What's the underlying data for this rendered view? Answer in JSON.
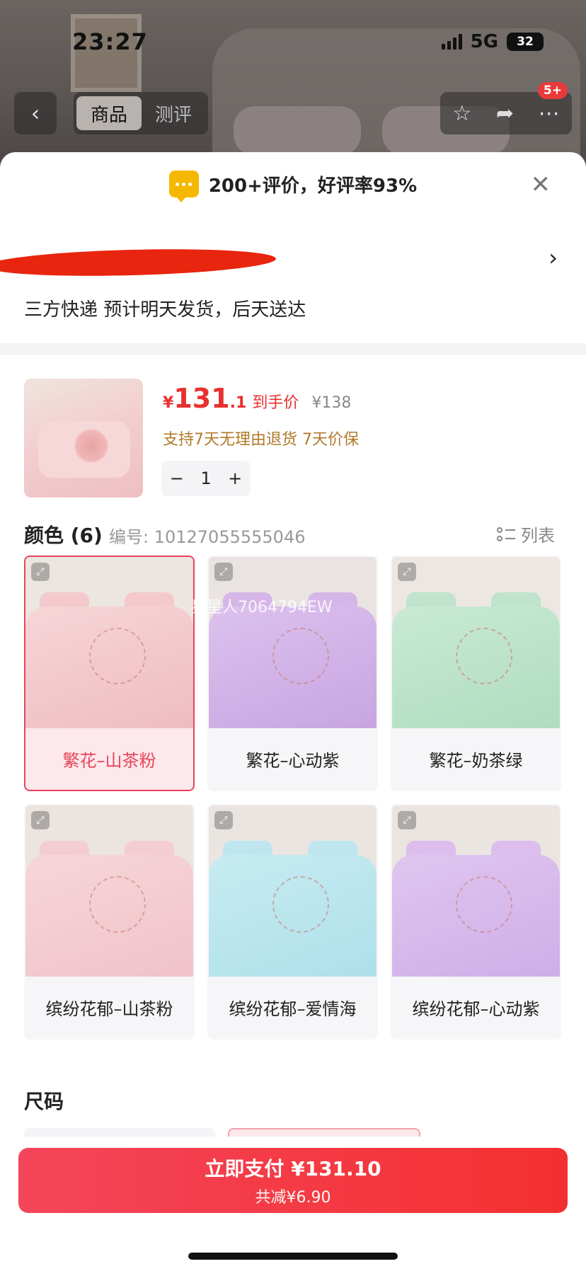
{
  "status_bar": {
    "time": "23:27",
    "network": "5G",
    "battery": "32"
  },
  "nav": {
    "back_icon": "chevron-left-icon",
    "tabs": [
      "商品",
      "测评"
    ],
    "actions": [
      "star-icon",
      "share-icon",
      "more-icon"
    ],
    "badge": "5+"
  },
  "sheet": {
    "rating_text": "200+评价，好评率93%",
    "delivery_text": "三方快递 预计明天发货，后天送达",
    "product": {
      "currency": "¥",
      "price_int": "131",
      "price_dec": ".1",
      "price_label": "到手价",
      "original_price": "¥138",
      "guarantee": "支持7天无理由退货  7天价保",
      "quantity": "1",
      "minus": "−",
      "plus": "+"
    },
    "color_section": {
      "title": "颜色 (6)",
      "code": "编号: 10127055555046",
      "list_label": "列表",
      "watermark": "星星人7064794EW",
      "options": [
        {
          "label": "繁花–山茶粉",
          "selected": true
        },
        {
          "label": "繁花–心动紫",
          "selected": false
        },
        {
          "label": "繁花–奶茶绿",
          "selected": false
        },
        {
          "label": "缤纷花郁–山茶粉",
          "selected": false
        },
        {
          "label": "缤纷花郁–爱情海",
          "selected": false
        },
        {
          "label": "缤纷花郁–心动紫",
          "selected": false
        }
      ]
    },
    "size_title": "尺码"
  },
  "pay": {
    "main": "立即支付 ¥131.10",
    "sub": "共减¥6.90"
  },
  "colors": {
    "accent": "#e8312f",
    "selected_border": "#e8445a",
    "rating_icon": "#f5b800"
  }
}
